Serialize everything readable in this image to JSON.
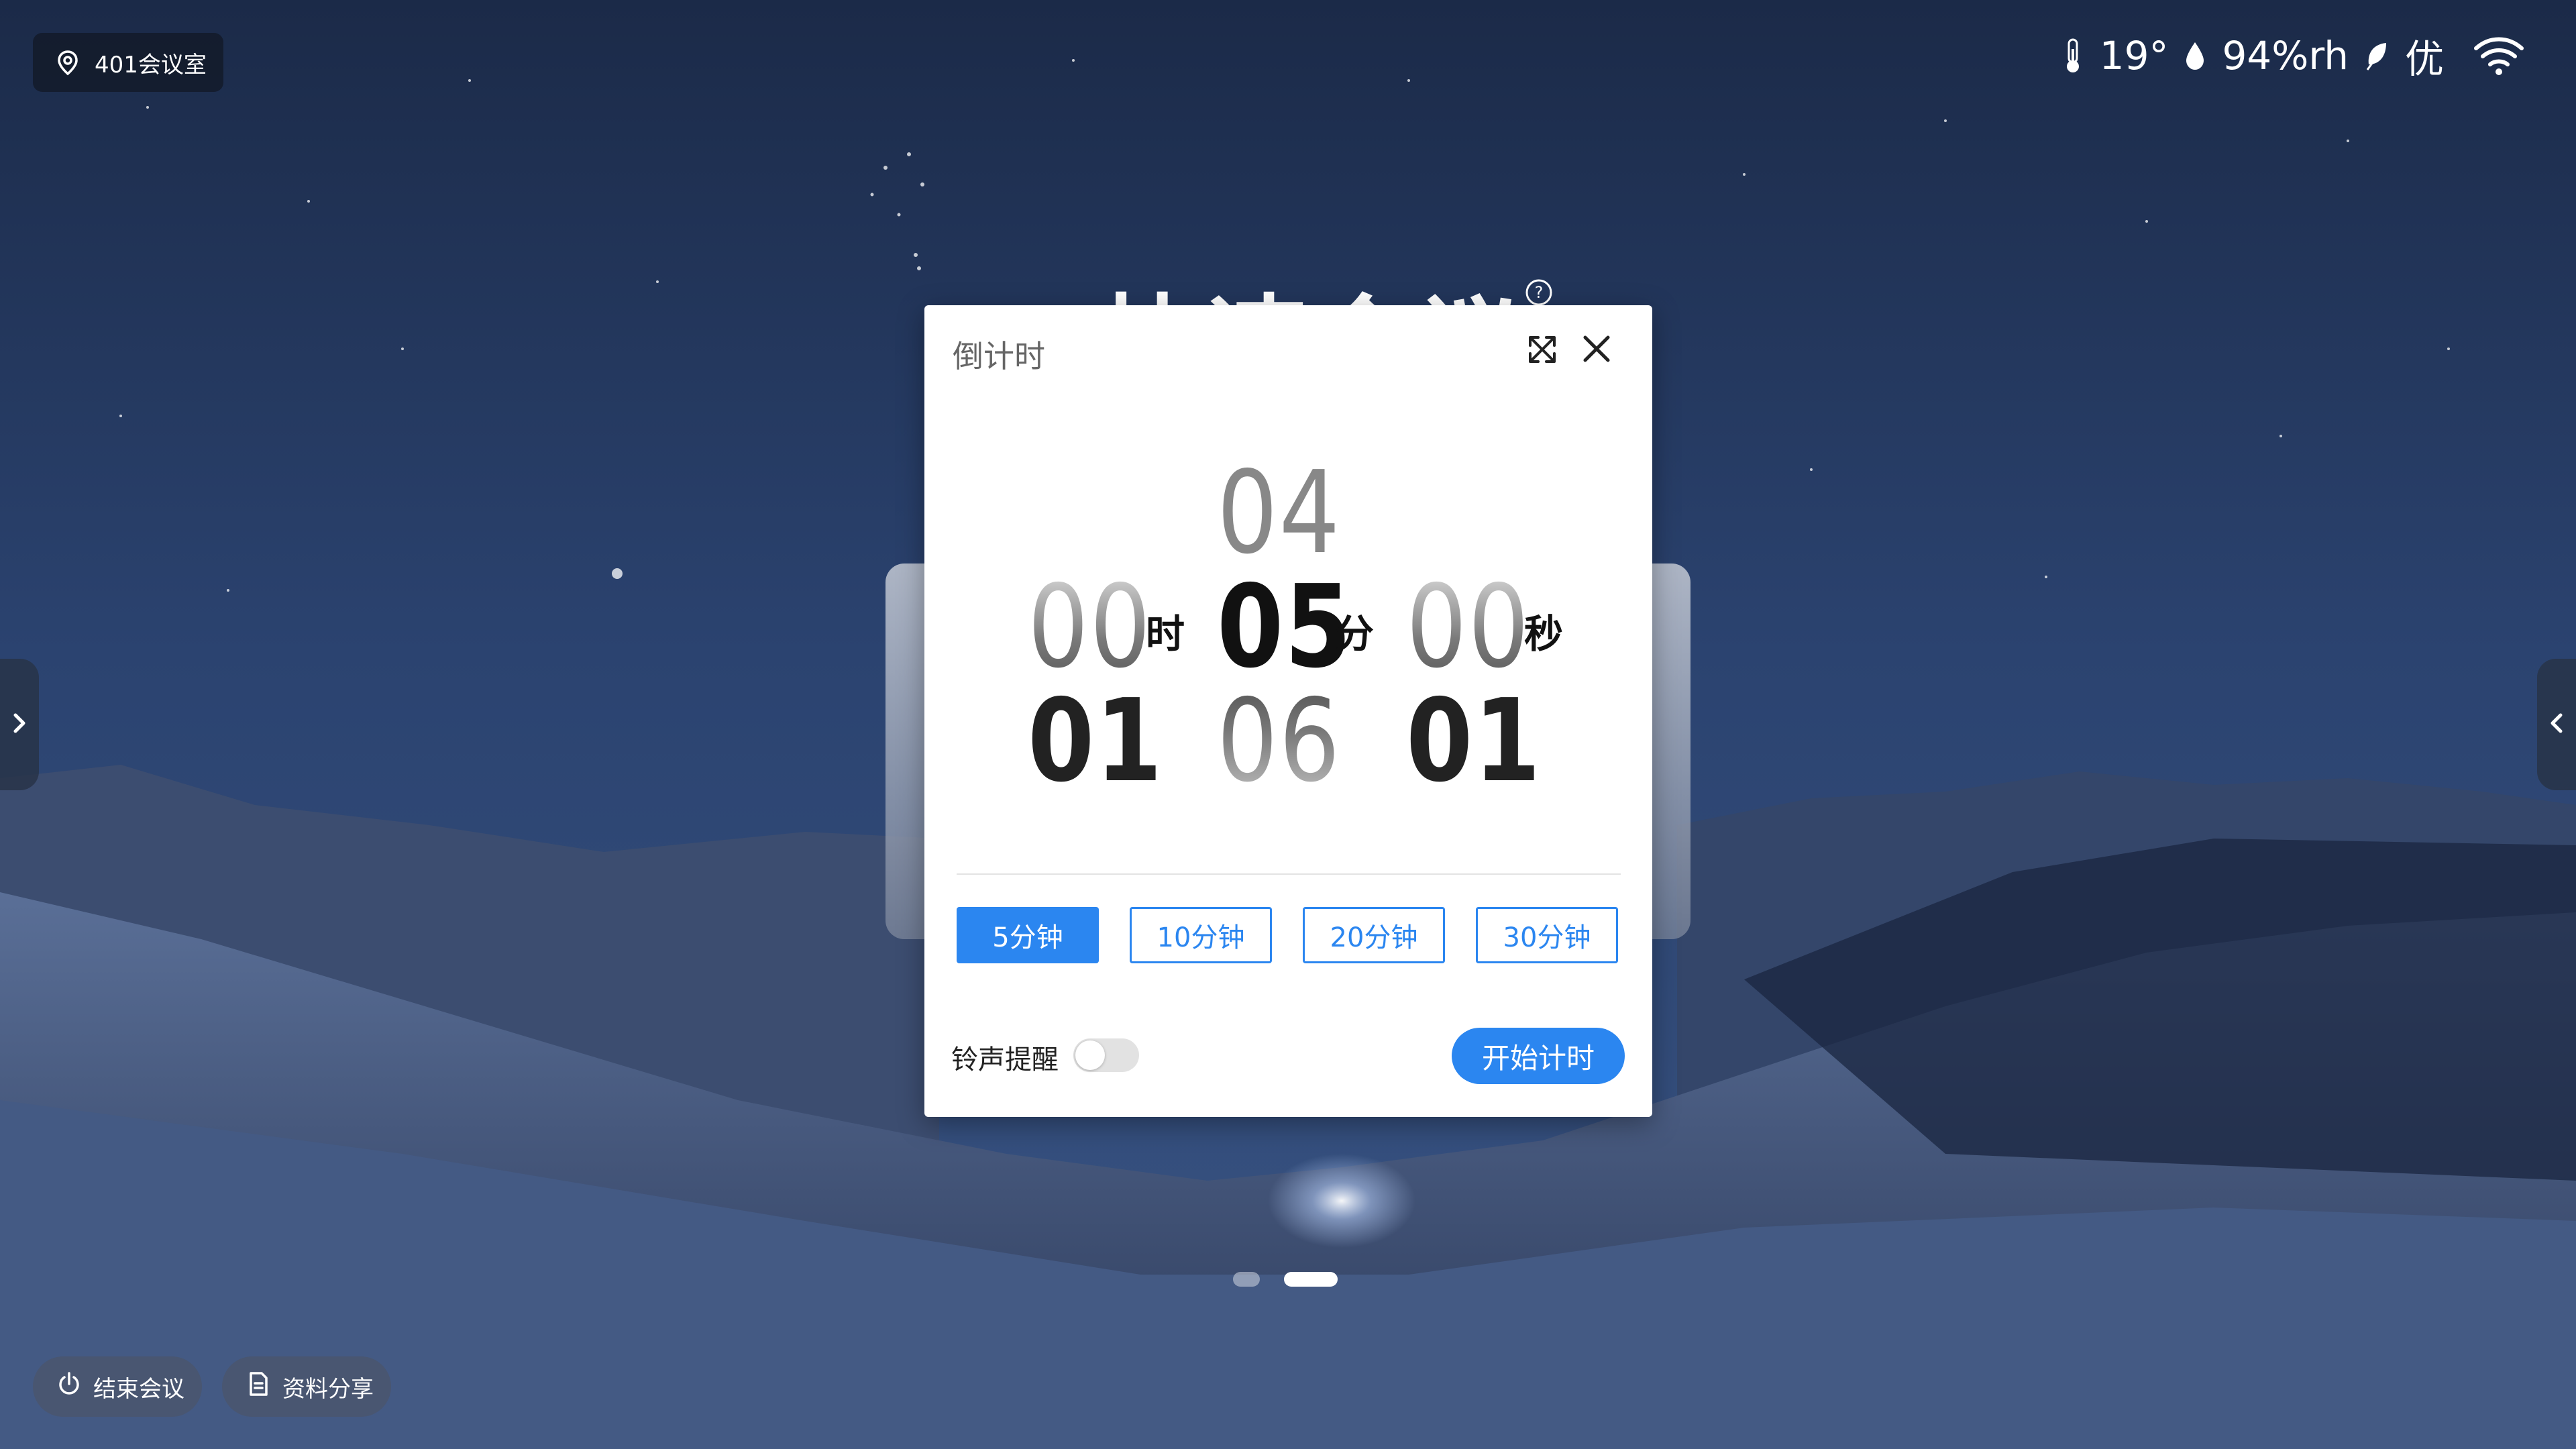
{
  "location": {
    "label": "401会议室",
    "icon": "location-pin-icon"
  },
  "status_bar": {
    "temperature": "19°",
    "humidity": "94%rh",
    "air_quality": "优",
    "icons": [
      "thermometer-icon",
      "droplet-icon",
      "leaf-icon",
      "wifi-icon"
    ]
  },
  "background": {
    "title": "快速会议"
  },
  "pager": {
    "total": 2,
    "active_index": 1
  },
  "bottom_actions": {
    "end_meeting": "结束会议",
    "share_files": "资料分享"
  },
  "countdown_modal": {
    "title": "倒计时",
    "hours": {
      "prev": "",
      "current": "00",
      "next": "01",
      "unit": "时"
    },
    "minutes": {
      "prev": "04",
      "current": "05",
      "next": "06",
      "unit": "分"
    },
    "seconds": {
      "prev": "",
      "current": "00",
      "next": "01",
      "unit": "秒"
    },
    "presets": [
      {
        "label": "5分钟",
        "active": true
      },
      {
        "label": "10分钟",
        "active": false
      },
      {
        "label": "20分钟",
        "active": false
      },
      {
        "label": "30分钟",
        "active": false
      }
    ],
    "ring_reminder_label": "铃声提醒",
    "ring_reminder_enabled": false,
    "start_label": "开始计时"
  },
  "colors": {
    "accent": "#2b86f0",
    "night_sky": "#1f3050"
  }
}
